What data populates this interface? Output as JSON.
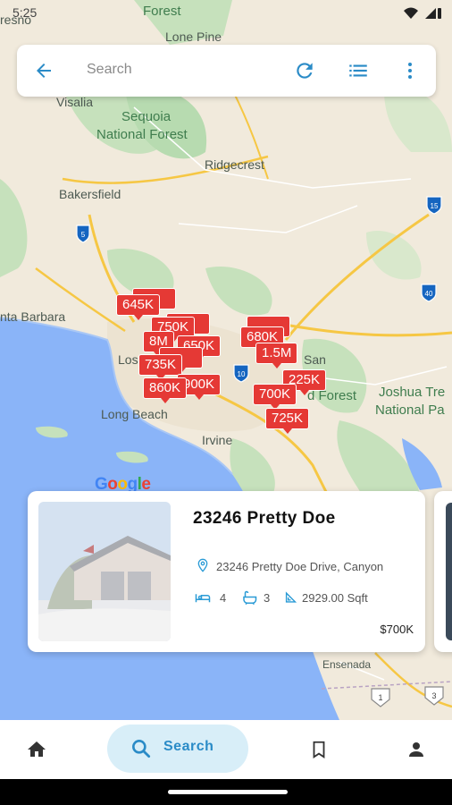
{
  "status_bar": {
    "time": "5:25"
  },
  "search": {
    "placeholder": "Search"
  },
  "toolbar_icons": [
    "back-arrow-icon",
    "refresh-icon",
    "list-icon",
    "more-vert-icon"
  ],
  "map": {
    "labels": {
      "forest": "Forest",
      "lone_pine": "Lone Pine",
      "visalia": "Visalia",
      "sequoia": "Sequoia",
      "national_forest": "National Forest",
      "ridgecrest": "Ridgecrest",
      "bakersfield": "Bakersfield",
      "santa_barbara": "nta Barbara",
      "long_beach": "Long Beach",
      "irvine": "Irvine",
      "joshua_tree": "Joshua Tre",
      "national_park": "National Pa",
      "san": "San",
      "forest_2": "d Forest",
      "ensenada": "Ensenada",
      "fresno": "resno",
      "los_angeles": "Los Angeles",
      "google": "Google"
    },
    "highway_shields": [
      "5",
      "15",
      "40",
      "10",
      "1",
      "3"
    ],
    "price_pins": {
      "p645": "645K",
      "p750": "750K",
      "p8m": "8M",
      "p650": "650K",
      "p735": "735K",
      "p860": "860K",
      "p900": "900K",
      "p680": "680K",
      "p15m": "1.5M",
      "p225": "225K",
      "p700": "700K",
      "p725": "725K"
    }
  },
  "listing": {
    "title": "23246 Pretty Doe",
    "address": "23246 Pretty Doe Drive, Canyon",
    "beds": "4",
    "baths": "3",
    "sqft": "2929.00 Sqft",
    "price": "$700K"
  },
  "bottom_nav": {
    "items": [
      {
        "icon": "home-icon"
      },
      {
        "icon": "search-icon",
        "label": "Search",
        "active": true
      },
      {
        "icon": "bookmark-icon"
      },
      {
        "icon": "person-icon"
      }
    ]
  },
  "colors": {
    "accent": "#2a8bc7",
    "pin": "#e53935",
    "ocean": "#8ab4f8",
    "land": "#f1eadc",
    "park": "#b7dbb0"
  }
}
